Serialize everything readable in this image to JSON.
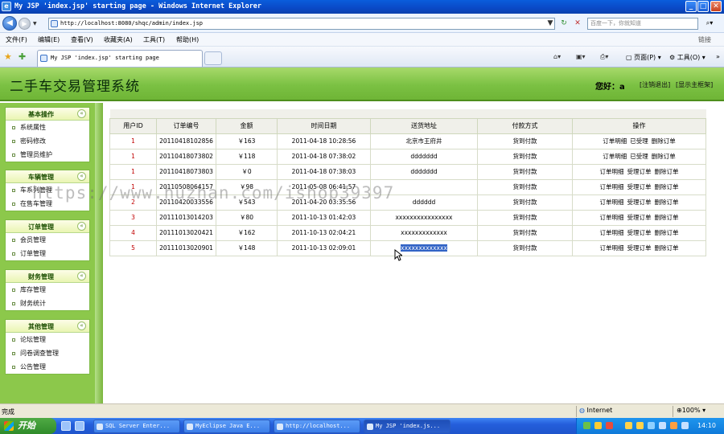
{
  "window": {
    "title": "My JSP 'index.jsp' starting page - Windows Internet Explorer",
    "min": "_",
    "max": "□",
    "close": "✕"
  },
  "address": {
    "url": "http://localhost:8080/shqc/admin/index.jsp",
    "search_placeholder": "百度一下，你就知道"
  },
  "menu": {
    "items": [
      "文件(F)",
      "编辑(E)",
      "查看(V)",
      "收藏夹(A)",
      "工具(T)",
      "帮助(H)"
    ],
    "brand": "链接"
  },
  "tabs": {
    "active": "My JSP 'index.jsp' starting page",
    "commands": [
      "页面(P)",
      "工具(O)"
    ]
  },
  "app": {
    "title": "二手车交易管理系统",
    "greeting": "您好：a",
    "logout": "[注销退出]",
    "show_frame": "[显示主框架]"
  },
  "sidebar": {
    "groups": [
      {
        "title": "基本操作",
        "items": [
          "系统属性",
          "密码修改",
          "管理员维护"
        ]
      },
      {
        "title": "车辆管理",
        "items": [
          "车系列管理",
          "在售车管理"
        ]
      },
      {
        "title": "订单管理",
        "items": [
          "会员管理",
          "订单管理"
        ]
      },
      {
        "title": "财务管理",
        "items": [
          "库存管理",
          "财务统计"
        ]
      },
      {
        "title": "其他管理",
        "items": [
          "论坛管理",
          "问卷调查管理",
          "公告管理"
        ]
      }
    ],
    "collapse_symbol": "«"
  },
  "orders": {
    "headers": [
      "用户ID",
      "订单编号",
      "金额",
      "时间日期",
      "送货地址",
      "付款方式",
      "操作"
    ],
    "rows": [
      {
        "uid": "1",
        "no": "20110418102856",
        "amount": "￥163",
        "time": "2011-04-18 10:28:56",
        "addr": "北京市王府井",
        "pay": "货到付款",
        "ops": [
          "订单明细",
          "已受理",
          "删除订单"
        ]
      },
      {
        "uid": "1",
        "no": "20110418073802",
        "amount": "￥118",
        "time": "2011-04-18 07:38:02",
        "addr": "ddddddd",
        "pay": "货到付款",
        "ops": [
          "订单明细",
          "已受理",
          "删除订单"
        ]
      },
      {
        "uid": "1",
        "no": "20110418073803",
        "amount": "￥0",
        "time": "2011-04-18 07:38:03",
        "addr": "ddddddd",
        "pay": "货到付款",
        "ops": [
          "订单明细",
          "受理订单",
          "删除订单"
        ]
      },
      {
        "uid": "1",
        "no": "20110508064157",
        "amount": "￥98",
        "time": "2011-05-08 06:41:57",
        "addr": "",
        "pay": "货到付款",
        "ops": [
          "订单明细",
          "受理订单",
          "删除订单"
        ]
      },
      {
        "uid": "2",
        "no": "20110420033556",
        "amount": "￥543",
        "time": "2011-04-20 03:35:56",
        "addr": "dddddd",
        "pay": "货到付款",
        "ops": [
          "订单明细",
          "受理订单",
          "删除订单"
        ]
      },
      {
        "uid": "3",
        "no": "20111013014203",
        "amount": "￥80",
        "time": "2011-10-13 01:42:03",
        "addr": "xxxxxxxxxxxxxxxx",
        "pay": "货到付款",
        "ops": [
          "订单明细",
          "受理订单",
          "删除订单"
        ]
      },
      {
        "uid": "4",
        "no": "20111013020421",
        "amount": "￥162",
        "time": "2011-10-13 02:04:21",
        "addr": "xxxxxxxxxxxxx",
        "pay": "货到付款",
        "ops": [
          "订单明细",
          "受理订单",
          "删除订单"
        ]
      },
      {
        "uid": "5",
        "no": "20111013020901",
        "amount": "￥148",
        "time": "2011-10-13 02:09:01",
        "addr": "xxxxxxxxxxxxx",
        "pay": "货到付款",
        "ops": [
          "订单明细",
          "受理订单",
          "删除订单"
        ],
        "addr_selected": true
      }
    ]
  },
  "watermark": "https://www.huzhan.com/ishop39397",
  "status": {
    "text": "完成",
    "zone": "Internet",
    "zoom": "100%"
  },
  "taskbar": {
    "start": "开始",
    "buttons": [
      "SQL Server Enter...",
      "MyEclipse Java E...",
      "http://localhost...",
      "My JSP 'index.js..."
    ],
    "clock": "14:10"
  }
}
